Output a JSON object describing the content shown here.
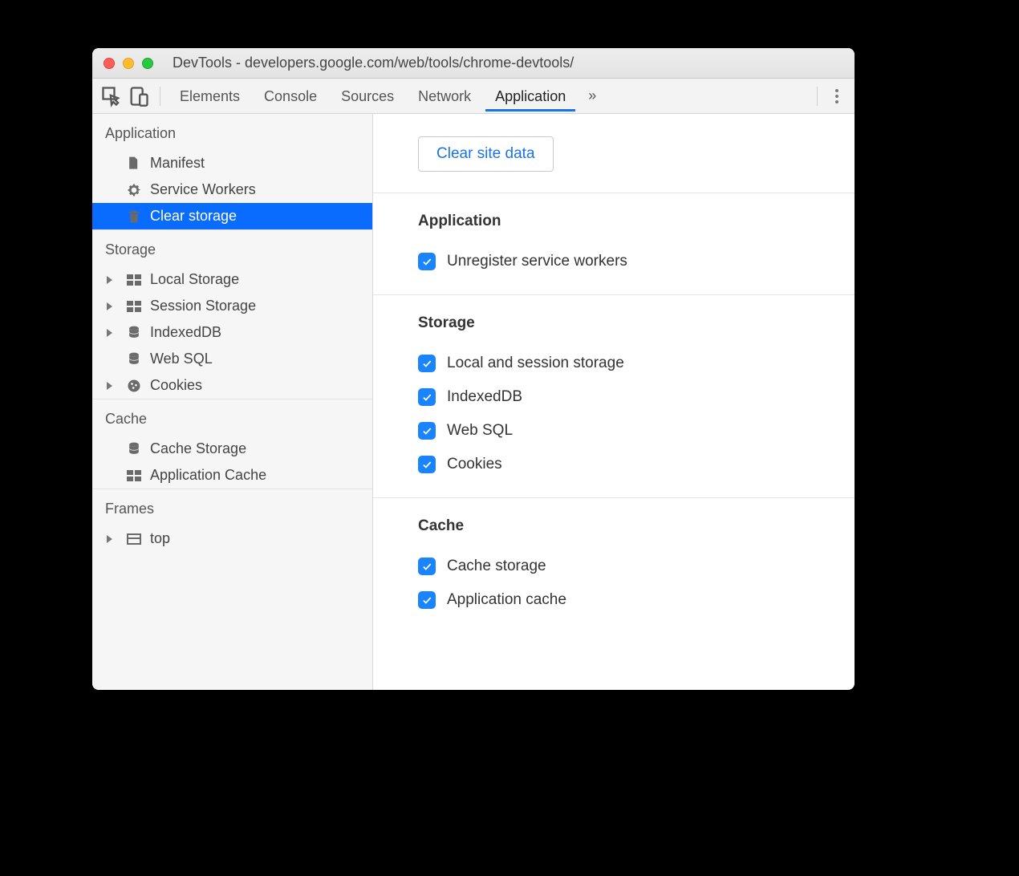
{
  "window_title": "DevTools - developers.google.com/web/tools/chrome-devtools/",
  "tabs": {
    "elements": "Elements",
    "console": "Console",
    "sources": "Sources",
    "network": "Network",
    "application": "Application"
  },
  "sidebar": {
    "groups": [
      {
        "title": "Application",
        "items": [
          {
            "label": "Manifest",
            "icon": "file-icon",
            "expandable": false
          },
          {
            "label": "Service Workers",
            "icon": "gear-icon",
            "expandable": false
          },
          {
            "label": "Clear storage",
            "icon": "trash-icon",
            "expandable": false,
            "selected": true
          }
        ]
      },
      {
        "title": "Storage",
        "items": [
          {
            "label": "Local Storage",
            "icon": "grid-icon",
            "expandable": true
          },
          {
            "label": "Session Storage",
            "icon": "grid-icon",
            "expandable": true
          },
          {
            "label": "IndexedDB",
            "icon": "database-icon",
            "expandable": true
          },
          {
            "label": "Web SQL",
            "icon": "database-icon",
            "expandable": false
          },
          {
            "label": "Cookies",
            "icon": "cookie-icon",
            "expandable": true
          }
        ]
      },
      {
        "title": "Cache",
        "items": [
          {
            "label": "Cache Storage",
            "icon": "database-icon",
            "expandable": false
          },
          {
            "label": "Application Cache",
            "icon": "grid-icon",
            "expandable": false
          }
        ]
      },
      {
        "title": "Frames",
        "items": [
          {
            "label": "top",
            "icon": "frame-icon",
            "expandable": true
          }
        ]
      }
    ]
  },
  "main": {
    "clear_button": "Clear site data",
    "sections": [
      {
        "heading": "Application",
        "items": [
          {
            "label": "Unregister service workers",
            "checked": true
          }
        ]
      },
      {
        "heading": "Storage",
        "items": [
          {
            "label": "Local and session storage",
            "checked": true
          },
          {
            "label": "IndexedDB",
            "checked": true
          },
          {
            "label": "Web SQL",
            "checked": true
          },
          {
            "label": "Cookies",
            "checked": true
          }
        ]
      },
      {
        "heading": "Cache",
        "items": [
          {
            "label": "Cache storage",
            "checked": true
          },
          {
            "label": "Application cache",
            "checked": true
          }
        ]
      }
    ]
  }
}
